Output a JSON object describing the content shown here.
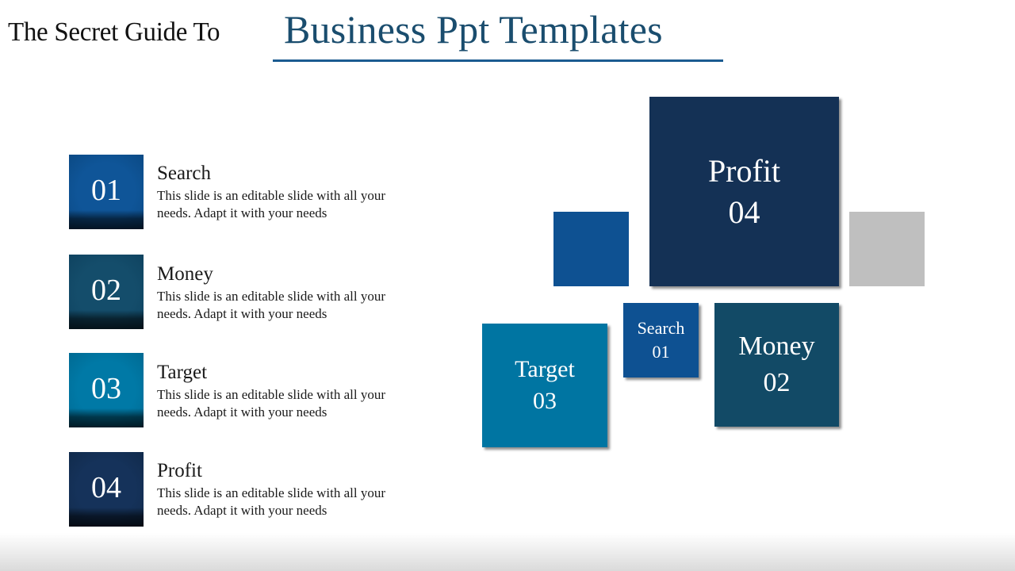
{
  "title": {
    "prefix": "The Secret Guide To",
    "highlight": "Business Ppt Templates"
  },
  "colors": {
    "search": "#0e5192",
    "money": "#124a66",
    "target": "#0075a2",
    "profit": "#143155",
    "accent_gray": "#bfbfbf",
    "title_blue": "#1a4d6e",
    "underline": "#1b5b91"
  },
  "items": [
    {
      "number": "01",
      "title": "Search",
      "description": "This slide is an editable slide with all your needs. Adapt it with your needs"
    },
    {
      "number": "02",
      "title": "Money",
      "description": "This slide is an editable slide with all your needs. Adapt it with your needs"
    },
    {
      "number": "03",
      "title": "Target",
      "description": "This slide is an editable slide with all your needs. Adapt it with your needs"
    },
    {
      "number": "04",
      "title": "Profit",
      "description": "This slide is an editable slide with all your needs. Adapt it with your needs"
    }
  ],
  "tiles": {
    "profit": {
      "label": "Profit",
      "number": "04"
    },
    "search": {
      "label": "Search",
      "number": "01"
    },
    "money": {
      "label": "Money",
      "number": "02"
    },
    "target": {
      "label": "Target",
      "number": "03"
    }
  }
}
